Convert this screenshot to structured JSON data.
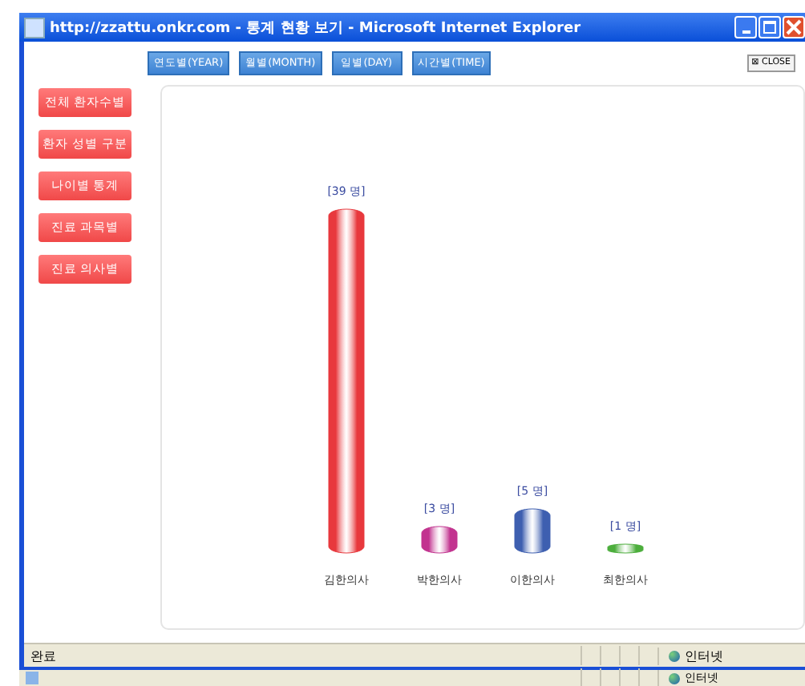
{
  "window": {
    "title": "http://zzattu.onkr.com - 통계 현황 보기 - Microsoft Internet Explorer"
  },
  "period_tabs": [
    {
      "label": "연도별(YEAR)"
    },
    {
      "label": "월별(MONTH)"
    },
    {
      "label": "일별(DAY)"
    },
    {
      "label": "시간별(TIME)"
    }
  ],
  "close_button": "⊠ CLOSE",
  "menu": [
    {
      "label": "전체 환자수별"
    },
    {
      "label": "환자 성별 구분"
    },
    {
      "label": "나이별 통계"
    },
    {
      "label": "진료 과목별"
    },
    {
      "label": "진료 의사별"
    }
  ],
  "chart": {
    "chart_data": {
      "type": "bar",
      "categories": [
        "김한의사",
        "박한의사",
        "이한의사",
        "최한의사"
      ],
      "series": [
        {
          "color": "#e8383d",
          "values": [
            39,
            null,
            null,
            null
          ],
          "value_labels": [
            "[39 명]",
            null,
            null,
            null
          ]
        },
        {
          "color": "#c2338f",
          "values": [
            null,
            3,
            null,
            null
          ],
          "value_labels": [
            null,
            "[3 명]",
            null,
            null
          ]
        },
        {
          "color": "#3e5fb0",
          "values": [
            null,
            null,
            5,
            null
          ],
          "value_labels": [
            null,
            null,
            "[5 명]",
            null
          ]
        },
        {
          "color": "#4cae3c",
          "values": [
            null,
            null,
            null,
            1
          ],
          "value_labels": [
            null,
            null,
            null,
            "[1 명]"
          ]
        }
      ]
    }
  },
  "status_bar": {
    "left": "완료",
    "zone": "인터넷"
  },
  "status_bar_behind": {
    "zone": "인터넷"
  }
}
